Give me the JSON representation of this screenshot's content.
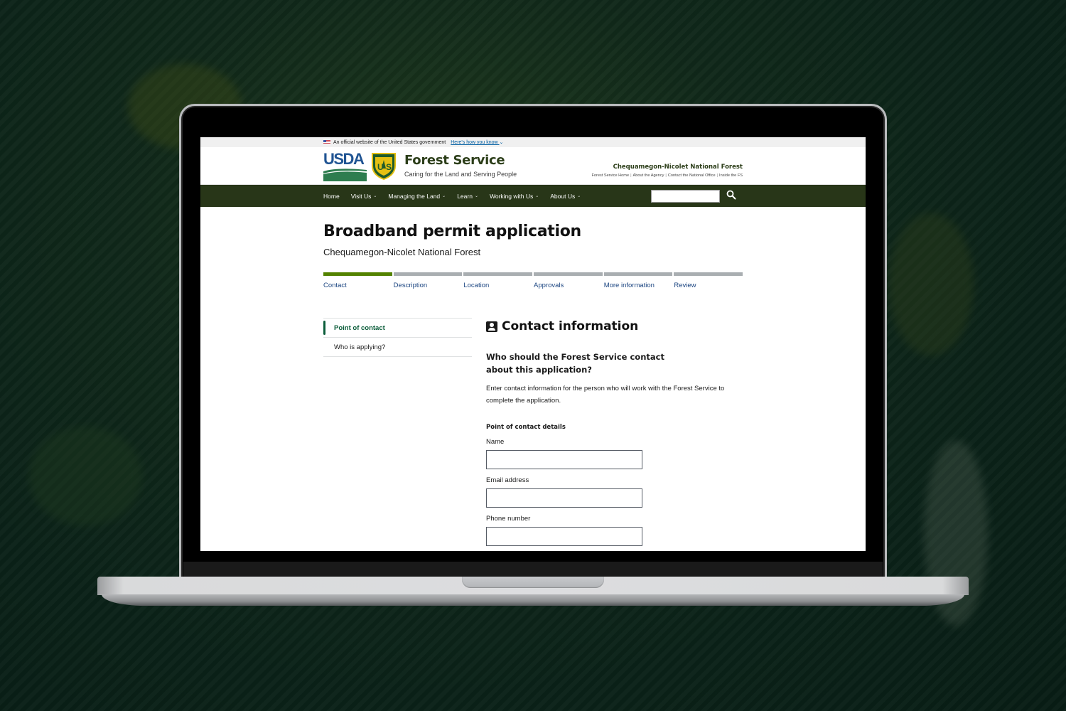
{
  "gov_banner": {
    "text": "An official website of the United States government",
    "link": "Here's how you know"
  },
  "header": {
    "usda_logo_text": "USDA",
    "shield_text": "US",
    "title": "Forest Service",
    "tagline": "Caring for the Land and Serving People",
    "forest_name": "Chequamegon-Nicolet National Forest",
    "utility_links": [
      "Forest Service Home",
      "About the Agency",
      "Contact the National Office",
      "Inside the FS"
    ]
  },
  "nav": {
    "items": [
      {
        "label": "Home",
        "has_menu": false
      },
      {
        "label": "Visit Us",
        "has_menu": true
      },
      {
        "label": "Managing the Land",
        "has_menu": true
      },
      {
        "label": "Learn",
        "has_menu": true
      },
      {
        "label": "Working with Us",
        "has_menu": true
      },
      {
        "label": "About Us",
        "has_menu": true
      }
    ],
    "search_value": "",
    "search_icon": "search-icon"
  },
  "page": {
    "title": "Broadband permit application",
    "subtitle": "Chequamegon-Nicolet National Forest"
  },
  "steps": {
    "current": 1,
    "total": 6,
    "items": [
      "Contact",
      "Description",
      "Location",
      "Approvals",
      "More information",
      "Review"
    ]
  },
  "side_nav": {
    "items": [
      {
        "label": "Point of contact",
        "active": true
      },
      {
        "label": "Who is applying?",
        "active": false
      }
    ]
  },
  "form": {
    "section_icon": "contact-card-icon",
    "section_title": "Contact information",
    "question": "Who should the Forest Service contact about this application?",
    "description": "Enter contact information for the person who will work with the Forest Service to complete the application.",
    "legend": "Point of contact details",
    "fields": [
      {
        "label": "Name",
        "value": ""
      },
      {
        "label": "Email address",
        "value": ""
      },
      {
        "label": "Phone number",
        "value": ""
      }
    ]
  },
  "colors": {
    "nav_bg": "#283618",
    "step_active": "#538200",
    "step_inactive": "#a9aeb1",
    "side_active": "#0b5d3a",
    "link": "#1a4480"
  }
}
